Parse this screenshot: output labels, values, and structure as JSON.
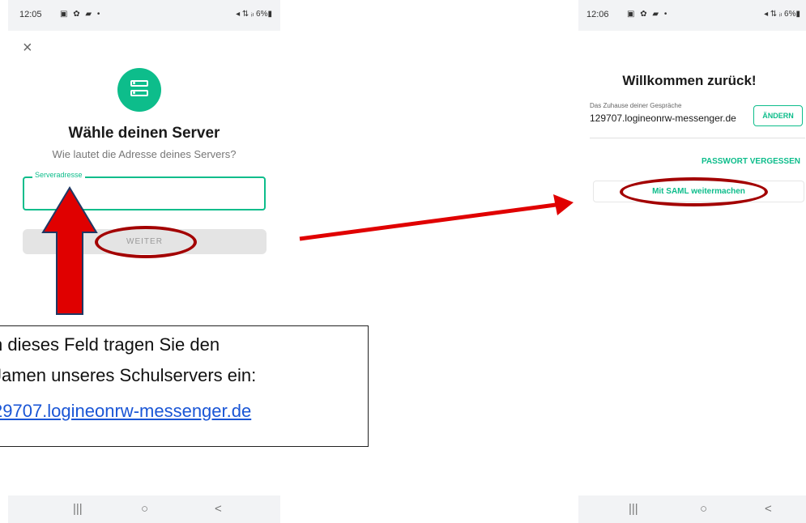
{
  "left_phone": {
    "status": {
      "time": "12:05",
      "icons": "▣ ✿ ▰ •",
      "right": "◂ ⇅ ᵢₗ 6%▮"
    },
    "close_icon": "×",
    "title": "Wähle deinen Server",
    "subtitle": "Wie lautet die Adresse deines Servers?",
    "field_label": "Serveradresse",
    "field_value": "",
    "continue_label": "WEITER",
    "nav": {
      "recents": "|||",
      "home": "○",
      "back": "<"
    }
  },
  "right_phone": {
    "status": {
      "time": "12:06",
      "icons": "▣ ✿ ▰ •",
      "right": "◂ ⇅ ᵢₗ 6%▮"
    },
    "title": "Willkommen zurück!",
    "home_caption": "Das Zuhause deiner Gespräche",
    "server_name": "129707.logineonrw-messenger.de",
    "change_label": "ÄNDERN",
    "forgot_label": "PASSWORT VERGESSEN",
    "saml_label": "Mit SAML weitermachen",
    "nav": {
      "recents": "|||",
      "home": "○",
      "back": "<"
    }
  },
  "annotation": {
    "line1": "n  dieses Feld tragen Sie den",
    "line2": "Jamen unseres Schulservers ein:",
    "line3": "29707.logineonrw-messenger.de"
  },
  "colors": {
    "accent": "#0dbd8b",
    "annotation_red": "#e00000",
    "ellipse": "#a30000",
    "link": "#1a56d6"
  }
}
